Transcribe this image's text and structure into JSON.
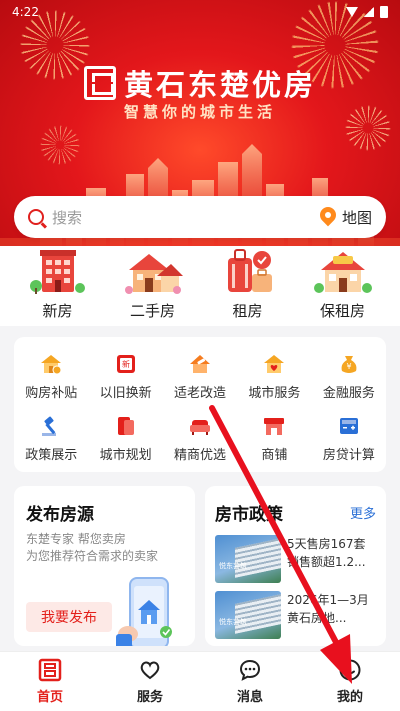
{
  "status_bar": {
    "time": "4:22"
  },
  "hero": {
    "title": "黄石东楚优房",
    "subtitle": "智慧你的城市生活"
  },
  "search": {
    "placeholder": "搜索",
    "map_label": "地图"
  },
  "main_categories": [
    {
      "label": "新房",
      "icon": "new-house-icon"
    },
    {
      "label": "二手房",
      "icon": "second-hand-house-icon"
    },
    {
      "label": "租房",
      "icon": "rental-luggage-icon"
    },
    {
      "label": "保租房",
      "icon": "affordable-rental-icon"
    }
  ],
  "services_row1": [
    {
      "label": "购房补贴",
      "icon": "house-subsidy-icon",
      "color": "#f5a623"
    },
    {
      "label": "以旧换新",
      "icon": "trade-in-icon",
      "color": "#e3201b"
    },
    {
      "label": "适老改造",
      "icon": "elderly-renovation-icon",
      "color": "#f57c1f"
    },
    {
      "label": "城市服务",
      "icon": "city-service-icon",
      "color": "#f5a623"
    },
    {
      "label": "金融服务",
      "icon": "finance-icon",
      "color": "#f5a623"
    }
  ],
  "services_row2": [
    {
      "label": "政策展示",
      "icon": "policy-gavel-icon",
      "color": "#2a6fd6"
    },
    {
      "label": "城市规划",
      "icon": "city-planning-icon",
      "color": "#e3201b"
    },
    {
      "label": "精商优选",
      "icon": "sofa-icon",
      "color": "#e3201b"
    },
    {
      "label": "商铺",
      "icon": "shop-icon",
      "color": "#e3201b"
    },
    {
      "label": "房贷计算",
      "icon": "calculator-icon",
      "color": "#2a6fd6"
    }
  ],
  "publish": {
    "title": "发布房源",
    "line1": "东楚专家 帮您卖房",
    "line2": "为您推荐符合需求的卖家",
    "button": "我要发布"
  },
  "market": {
    "title": "房市政策",
    "more": "更多",
    "news": [
      {
        "text": "5天售房167套 销售额超1.2...",
        "thumb_label": "悦东芸筑"
      },
      {
        "text": "2026年1—3月 黄石房地...",
        "thumb_label": "悦东芸筑"
      }
    ]
  },
  "bottom_nav": [
    {
      "label": "首页",
      "icon": "home-logo-icon",
      "active": true
    },
    {
      "label": "服务",
      "icon": "heart-icon",
      "active": false
    },
    {
      "label": "消息",
      "icon": "message-icon",
      "active": false
    },
    {
      "label": "我的",
      "icon": "profile-smile-icon",
      "active": false
    }
  ],
  "colors": {
    "brand_red": "#e3201b",
    "accent_orange": "#ff8a1c",
    "link_blue": "#2a6fd6"
  }
}
